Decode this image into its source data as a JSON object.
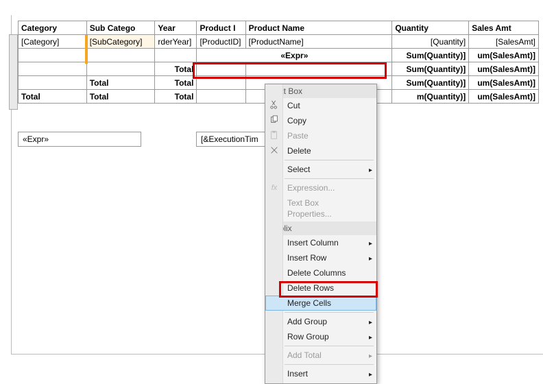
{
  "table": {
    "headers": {
      "category": "Category",
      "subcategory": "Sub Catego",
      "year": "Year",
      "productid": "Product I",
      "productname": "Product Name",
      "quantity": "Quantity",
      "salesamt": "Sales Amt"
    },
    "detail": {
      "category": "[Category]",
      "subcategory": "[SubCategory]",
      "year": "rderYear]",
      "productid": "[ProductID]",
      "productname": "[ProductName]",
      "quantity": "[Quantity]",
      "salesamt": "[SalesAmt]"
    },
    "groupExprRow": {
      "expr": "«Expr»",
      "qty": "Sum(Quantity)]",
      "amt": "um(SalesAmt)]"
    },
    "subtotalRows": [
      {
        "label": "Total",
        "qty": "Sum(Quantity)]",
        "amt": "um(SalesAmt)]"
      },
      {
        "label": "Total",
        "label2": "Total",
        "qty": "Sum(Quantity)]",
        "amt": "um(SalesAmt)]"
      }
    ],
    "grandTotal": {
      "c1": "Total",
      "c2": "Total",
      "c3": "Total",
      "qty": "m(Quantity)]",
      "amt": "um(SalesAmt)]"
    }
  },
  "footer": {
    "expr": "«Expr»",
    "exectime": "[&ExecutionTim"
  },
  "contextMenu": {
    "header1": "Text Box",
    "cut": "Cut",
    "copy": "Copy",
    "paste": "Paste",
    "delete": "Delete",
    "select": "Select",
    "expression": "Expression...",
    "tbprops": "Text Box Properties...",
    "header2": "Tablix",
    "insertcol": "Insert Column",
    "insertrow": "Insert Row",
    "delcols": "Delete Columns",
    "delrows": "Delete Rows",
    "merge": "Merge Cells",
    "addgroup": "Add Group",
    "rowgroup": "Row Group",
    "addtotal": "Add Total",
    "insert": "Insert"
  },
  "icons": {
    "cut": "cut-icon",
    "copy": "copy-icon",
    "paste": "paste-icon",
    "delete": "delete-icon",
    "fx": "fx-icon"
  }
}
